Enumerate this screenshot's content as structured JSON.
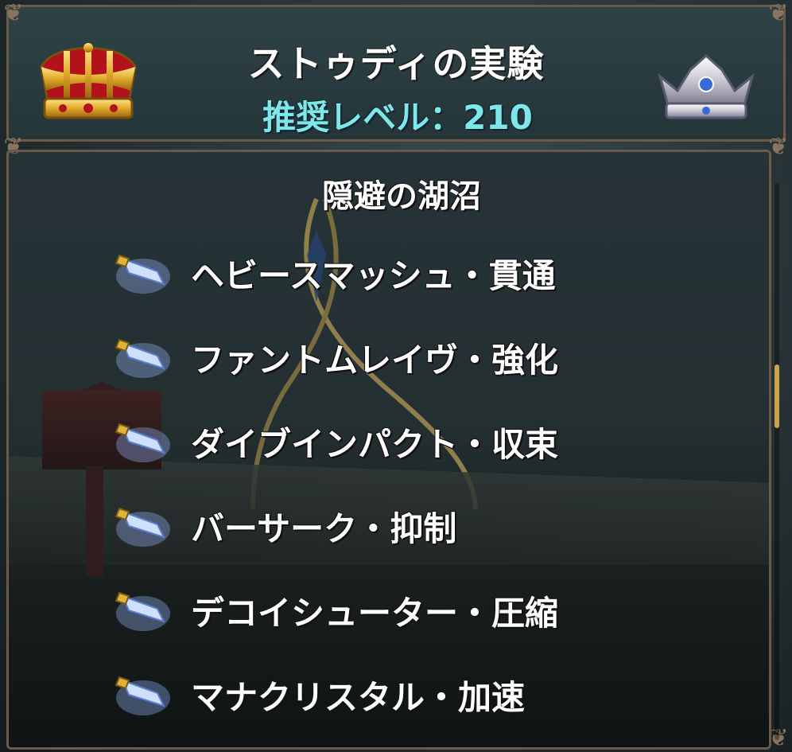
{
  "header": {
    "title": "ストゥディの実験",
    "recommended_level": "推奨レベル：210",
    "left_icon": "gold-crown-icon",
    "right_icon": "silver-crown-icon"
  },
  "area": {
    "name": "隠避の湖沼"
  },
  "skills": [
    {
      "label": "ヘビースマッシュ・貫通",
      "icon": "crystal-scroll-icon"
    },
    {
      "label": "ファントムレイヴ・強化",
      "icon": "crystal-scroll-icon"
    },
    {
      "label": "ダイブインパクト・収束",
      "icon": "crystal-scroll-icon"
    },
    {
      "label": "バーサーク・抑制",
      "icon": "crystal-scroll-icon"
    },
    {
      "label": "デコイシューター・圧縮",
      "icon": "crystal-scroll-icon"
    },
    {
      "label": "マナクリスタル・加速",
      "icon": "crystal-scroll-icon"
    }
  ],
  "colors": {
    "title": "#ffffff",
    "level": "#7ee8e8",
    "frame": "#6b5a4a",
    "scroll_thumb": "#c9a24a"
  }
}
